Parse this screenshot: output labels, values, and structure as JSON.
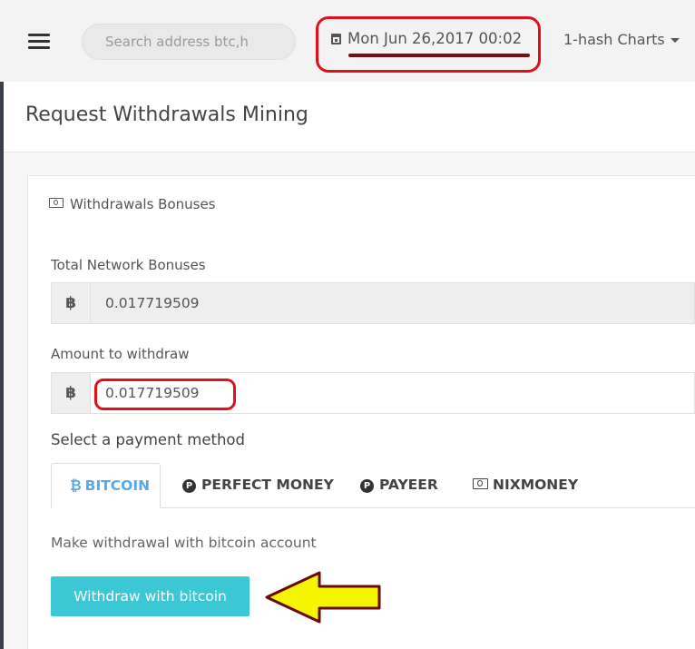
{
  "header": {
    "search_placeholder": "Search address btc,h",
    "datetime": "Mon Jun 26,2017 00:02",
    "charts_menu": "1-hash Charts"
  },
  "page": {
    "title": "Request Withdrawals Mining"
  },
  "panel": {
    "heading": "Withdrawals Bonuses",
    "total_label": "Total Network Bonuses",
    "total_addon": "฿",
    "total_value": "0.017719509",
    "amount_label": "Amount to withdraw",
    "amount_addon": "฿",
    "amount_value": "0.017719509",
    "payment_label": "Select a payment method",
    "tabs": [
      {
        "glyph": "₿",
        "label": "BITCOIN"
      },
      {
        "glyph": "P",
        "label": "PERFECT MONEY"
      },
      {
        "glyph": "P",
        "label": "PAYEER"
      },
      {
        "glyph": "money-icon",
        "label": "NIXMONEY"
      }
    ],
    "description": "Make withdrawal with bitcoin account",
    "button_label": "Withdraw with bitcoin"
  },
  "annotations": {
    "highlight_color": "#e0101a",
    "arrow_color": "#f5f500"
  }
}
